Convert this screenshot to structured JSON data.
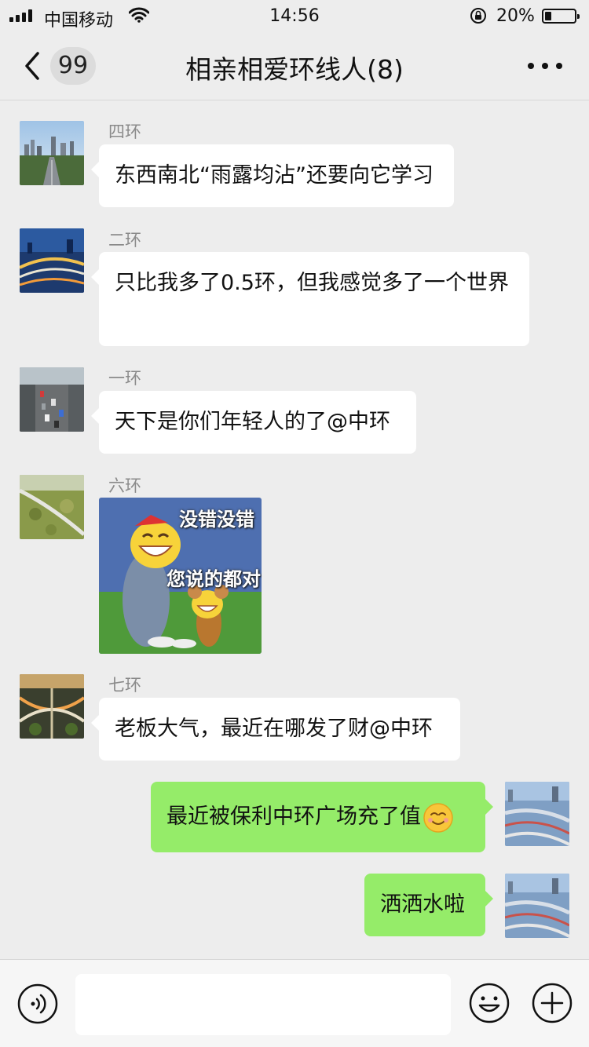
{
  "status_bar": {
    "carrier": "中国移动",
    "time": "14:56",
    "battery_percent": "20%",
    "battery_level": 0.2,
    "icons": [
      "signal-icon",
      "wifi-icon",
      "orientation-lock-icon",
      "battery-icon"
    ]
  },
  "nav": {
    "unread_count": "99",
    "title": "相亲相爱环线人(8)",
    "icons": [
      "back-chevron-icon",
      "more-dots-icon"
    ]
  },
  "messages": [
    {
      "sender": "四环",
      "text": "东西南北“雨露均沾”还要向它学习",
      "side": "left"
    },
    {
      "sender": "二环",
      "text": "只比我多了0.5环，但我感觉多了一个世界",
      "side": "left"
    },
    {
      "sender": "一环",
      "text": "天下是你们年轻人的了@中环",
      "side": "left"
    },
    {
      "sender": "六环",
      "sticker_caption_1": "没错没错",
      "sticker_caption_2": "您说的都对",
      "side": "left"
    },
    {
      "sender": "七环",
      "text": "老板大气，最近在哪发了财@中环",
      "side": "left"
    },
    {
      "text": "最近被保利中环广场充了值",
      "emoji": "smiling-face-emoji",
      "side": "right"
    },
    {
      "text": "洒洒水啦",
      "side": "right"
    }
  ],
  "input_bar": {
    "placeholder": "",
    "icons": [
      "voice-icon",
      "emoji-icon",
      "plus-icon"
    ]
  },
  "colors": {
    "background": "#ededed",
    "incoming_bubble": "#ffffff",
    "outgoing_bubble": "#95ec69",
    "sender_name": "#8a8a8a"
  }
}
